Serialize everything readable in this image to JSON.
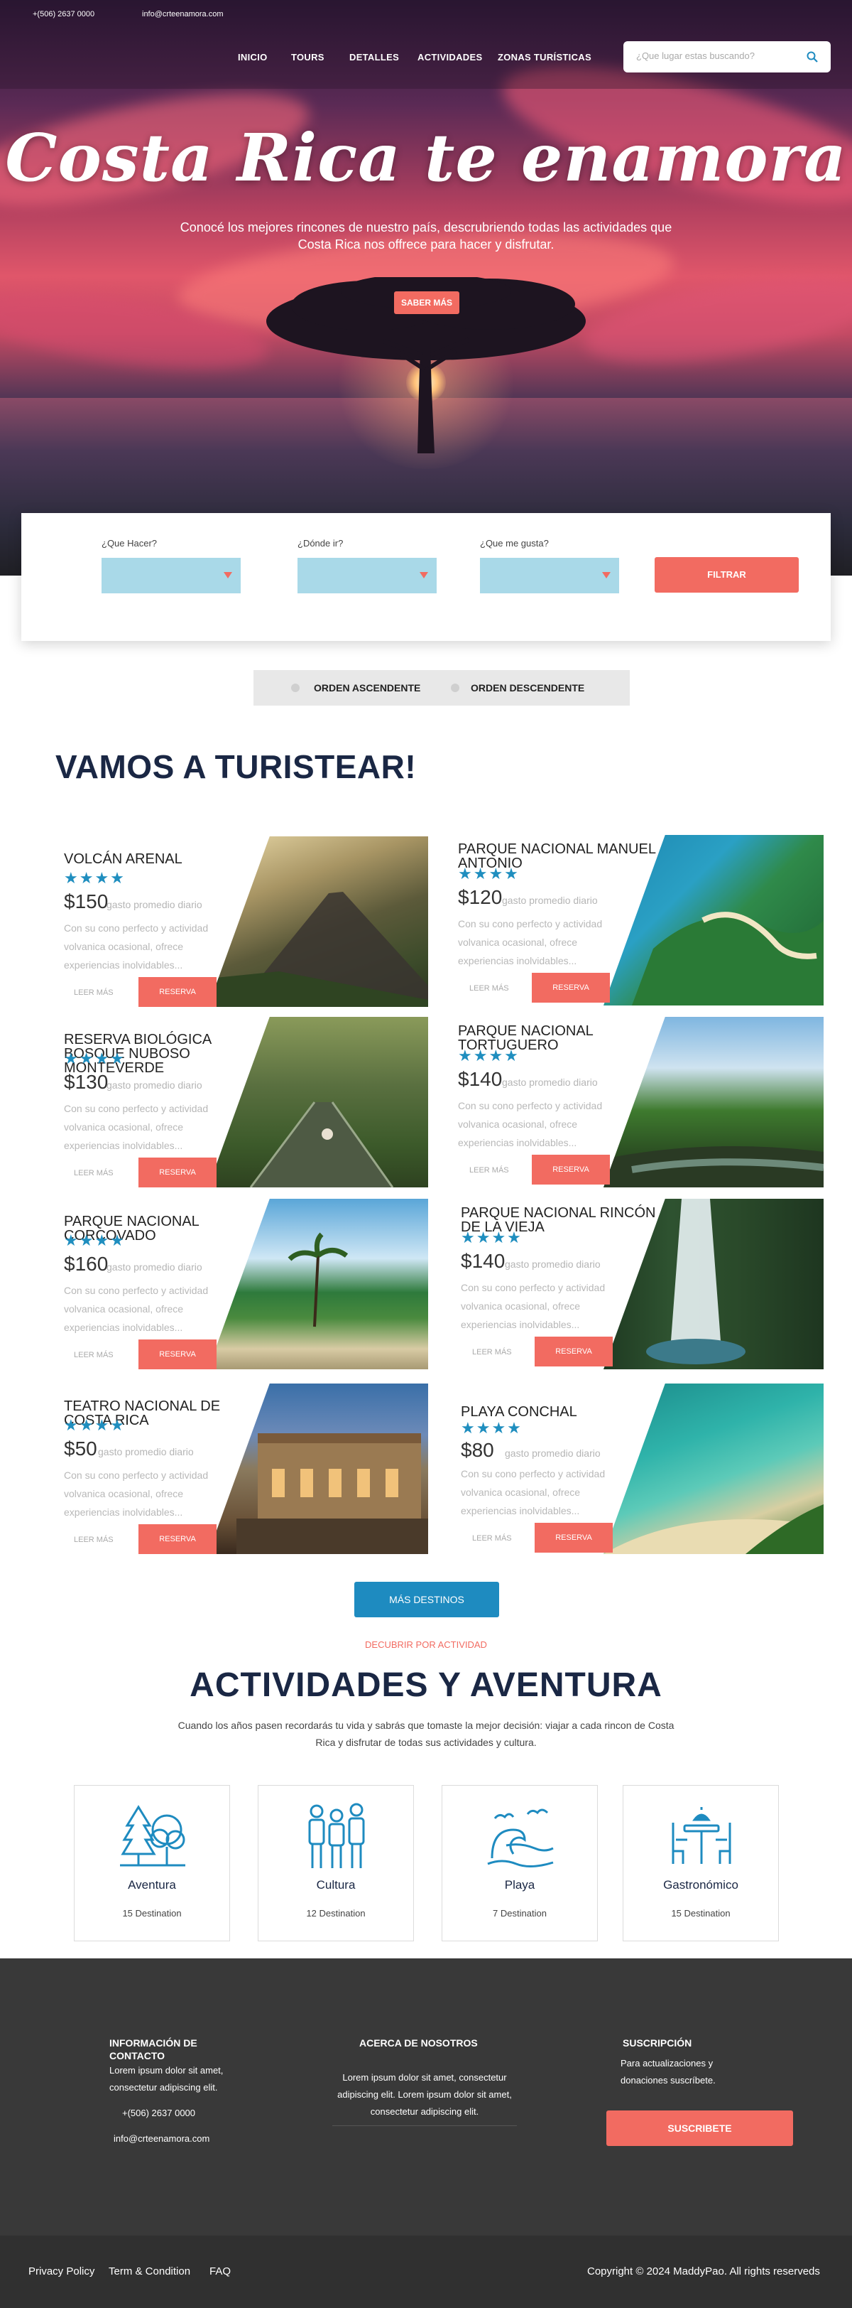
{
  "topbar": {
    "phone": "+(506) 2637 0000",
    "email": "info@crteenamora.com"
  },
  "nav": {
    "items": [
      "INICIO",
      "TOURS",
      "DETALLES",
      "ACTIVIDADES",
      "ZONAS TURÍSTICAS"
    ]
  },
  "search": {
    "placeholder": "¿Que lugar estas buscando?",
    "icon": "search-icon"
  },
  "hero": {
    "title": "Costa Rica te enamora",
    "subtitle": "Conocé los mejores rincones de nuestro país, descrubriendo todas las actividades que Costa Rica nos offrece para hacer y disfrutar.",
    "cta": "SABER MÁS"
  },
  "filter": {
    "que_hacer": "¿Que Hacer?",
    "donde_ir": "¿Dónde ir?",
    "que_gusta": "¿Que me gusta?",
    "button": "FILTRAR"
  },
  "order": {
    "asc": "ORDEN ASCENDENTE",
    "desc": "ORDEN DESCENDENTE"
  },
  "section_title": "VAMOS A TURISTEAR!",
  "destinations": [
    {
      "name": "VOLCÁN ARENAL",
      "stars": "★★★★",
      "price": "$150",
      "per": "gasto promedio diario",
      "desc": "Con su cono perfecto y actividad volvanica ocasional, ofrece experiencias inolvidables...",
      "read_more": "LEER MÁS",
      "reserve": "RESERVA"
    },
    {
      "name": "PARQUE NACIONAL MANUEL ANTONIO",
      "stars": "★★★★",
      "price": "$120",
      "per": "gasto promedio diario",
      "desc": "Con su cono perfecto y actividad volvanica ocasional, ofrece experiencias inolvidables...",
      "read_more": "LEER MÁS",
      "reserve": "RESERVA"
    },
    {
      "name": "RESERVA BIOLÓGICA BOSQUE NUBOSO MONTEVERDE",
      "stars": "★★★★",
      "price": "$130",
      "per": "gasto promedio diario",
      "desc": "Con su cono perfecto y actividad volvanica ocasional, ofrece experiencias inolvidables...",
      "read_more": "LEER MÁS",
      "reserve": "RESERVA"
    },
    {
      "name": "PARQUE NACIONAL TORTUGUERO",
      "stars": "★★★★",
      "price": "$140",
      "per": "gasto promedio diario",
      "desc": "Con su cono perfecto y actividad volvanica ocasional, ofrece experiencias inolvidables...",
      "read_more": "LEER MÁS",
      "reserve": "RESERVA"
    },
    {
      "name": "PARQUE NACIONAL CORCOVADO",
      "stars": "★★★★",
      "price": "$160",
      "per": "gasto promedio diario",
      "desc": "Con su cono perfecto y actividad volvanica ocasional, ofrece experiencias inolvidables...",
      "read_more": "LEER MÁS",
      "reserve": "RESERVA"
    },
    {
      "name": "PARQUE NACIONAL RINCÓN DE LA VIEJA",
      "stars": "★★★★",
      "price": "$140",
      "per": "gasto promedio diario",
      "desc": "Con su cono perfecto y actividad volvanica ocasional, ofrece experiencias inolvidables...",
      "read_more": "LEER MÁS",
      "reserve": "RESERVA"
    },
    {
      "name": "TEATRO NACIONAL DE COSTA RICA",
      "stars": "★★★★",
      "price": "$50",
      "per": "gasto promedio diario",
      "desc": "Con su cono perfecto y actividad volvanica ocasional, ofrece experiencias inolvidables...",
      "read_more": "LEER MÁS",
      "reserve": "RESERVA"
    },
    {
      "name": "PLAYA CONCHAL",
      "stars": "★★★★",
      "price": "$80",
      "per": "gasto promedio diario",
      "desc": "Con su cono perfecto y actividad volvanica ocasional, ofrece experiencias inolvidables...",
      "read_more": "LEER MÁS",
      "reserve": "RESERVA"
    }
  ],
  "more_button": "MÁS DESTINOS",
  "activities": {
    "eyebrow": "DECUBRIR POR ACTIVIDAD",
    "title": "ACTIVIDADES Y AVENTURA",
    "intro": "Cuando los años pasen recordarás tu vida y sabrás que tomaste la mejor decisión: viajar a cada rincon de Costa Rica y disfrutar de todas sus actividades y cultura.",
    "items": [
      {
        "title": "Aventura",
        "count": "15 Destination",
        "icon": "forest-icon"
      },
      {
        "title": "Cultura",
        "count": "12 Destination",
        "icon": "people-icon"
      },
      {
        "title": "Playa",
        "count": "7 Destination",
        "icon": "beach-wave-icon"
      },
      {
        "title": "Gastronómico",
        "count": "15 Destination",
        "icon": "dining-table-icon"
      }
    ]
  },
  "footer": {
    "contact_title": "INFORMACIÓN DE CONTACTO",
    "contact_text": "Lorem ipsum dolor sit amet, consectetur adipiscing elit.",
    "phone": "+(506) 2637 0000",
    "email": "info@crteenamora.com",
    "about_title": "ACERCA DE NOSOTROS",
    "about_text": "Lorem ipsum dolor sit amet, consectetur adipiscing elit. Lorem ipsum dolor sit amet, consectetur adipiscing elit.",
    "subs_title": "SUSCRIPCIÓN",
    "subs_text": "Para actualizaciones y donaciones suscríbete.",
    "subs_button": "SUSCRIBETE"
  },
  "bottom": {
    "privacy": "Privacy Policy",
    "terms": "Term & Condition",
    "faq": "FAQ",
    "copyright": "Copyright © 2024 MaddyPao. All rights reserveds"
  },
  "colors": {
    "accent": "#f26b61",
    "primary_blue": "#1e8bc0",
    "navy": "#1a2744",
    "select_bg": "#a9d9e8",
    "footer": "#393939"
  }
}
